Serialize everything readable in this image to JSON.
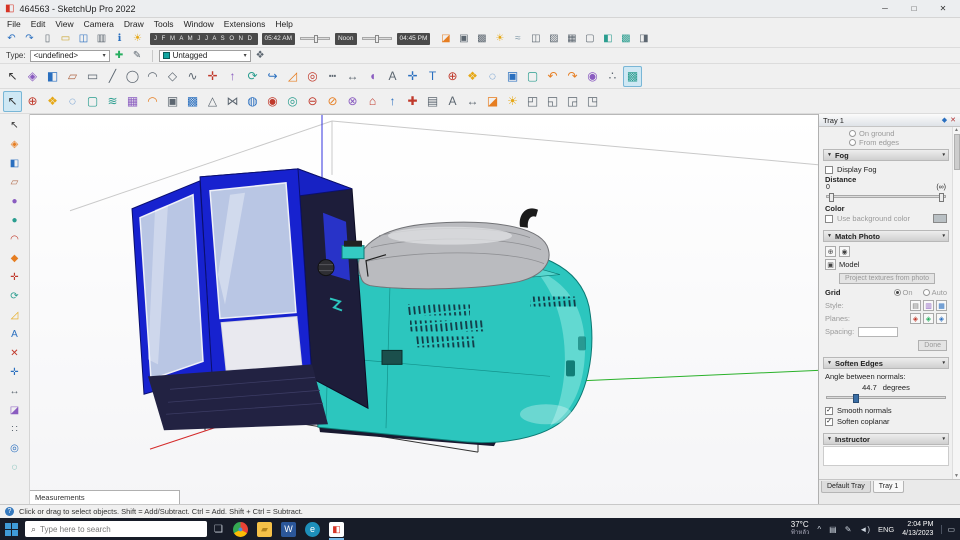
{
  "window": {
    "title": "464563 - SketchUp Pro 2022",
    "logo_glyph": "◧",
    "controls": {
      "min": "─",
      "max": "□",
      "close": "✕"
    }
  },
  "menu": {
    "items": [
      {
        "n": "menu-file",
        "label": "File"
      },
      {
        "n": "menu-edit",
        "label": "Edit"
      },
      {
        "n": "menu-view",
        "label": "View"
      },
      {
        "n": "menu-camera",
        "label": "Camera"
      },
      {
        "n": "menu-draw",
        "label": "Draw"
      },
      {
        "n": "menu-tools",
        "label": "Tools"
      },
      {
        "n": "menu-window",
        "label": "Window"
      },
      {
        "n": "menu-extensions",
        "label": "Extensions"
      },
      {
        "n": "menu-help",
        "label": "Help"
      }
    ]
  },
  "toolbar_a": {
    "left_icons": [
      {
        "n": "undo-icon",
        "g": "↶",
        "c": "#2a6fbf"
      },
      {
        "n": "redo-icon",
        "g": "↷",
        "c": "#2a6fbf"
      },
      {
        "n": "new-file-icon",
        "g": "▯",
        "c": "#5c6670"
      },
      {
        "n": "open-file-icon",
        "g": "▭",
        "c": "#c9a227"
      },
      {
        "n": "save-icon",
        "g": "◫",
        "c": "#2a6fbf"
      },
      {
        "n": "print-icon",
        "g": "▥",
        "c": "#5c6670"
      },
      {
        "n": "model-info-icon",
        "g": "ℹ",
        "c": "#2a6fbf"
      },
      {
        "n": "shadow-settings-icon",
        "g": "☀",
        "c": "#e6a817"
      }
    ],
    "months": "J F M A M J J A S O N D",
    "time_start": "05:42 AM",
    "time_noon": "Noon",
    "time_end": "04:45 PM",
    "right_icons": [
      {
        "n": "section-plane-icon",
        "g": "◪",
        "c": "#e67e22"
      },
      {
        "n": "section-cuts-icon",
        "g": "▣",
        "c": "#5c6670"
      },
      {
        "n": "section-fill-icon",
        "g": "▩",
        "c": "#5c6670"
      },
      {
        "n": "shadows-toggle-icon",
        "g": "☀",
        "c": "#e6a817"
      },
      {
        "n": "fog-toggle-icon",
        "g": "≈",
        "c": "#7f98a8"
      },
      {
        "n": "xray-icon",
        "g": "◫",
        "c": "#5c6670"
      },
      {
        "n": "back-edges-icon",
        "g": "▨",
        "c": "#5c6670"
      },
      {
        "n": "wireframe-icon",
        "g": "▦",
        "c": "#5c6670"
      },
      {
        "n": "hidden-line-icon",
        "g": "▢",
        "c": "#5c6670"
      },
      {
        "n": "shaded-icon",
        "g": "◧",
        "c": "#2a9d8f"
      },
      {
        "n": "textured-icon",
        "g": "▩",
        "c": "#2a9d8f"
      },
      {
        "n": "monochrome-icon",
        "g": "◨",
        "c": "#5c6670"
      }
    ]
  },
  "toolbar_b": {
    "type_label": "Type:",
    "type_value": "<undefined>",
    "tag_value": "Untagged",
    "icons": [
      {
        "n": "add-type-icon",
        "g": "✚",
        "c": "#27ae60"
      },
      {
        "n": "edit-type-icon",
        "g": "✎",
        "c": "#5c6670"
      }
    ],
    "end_icons": [
      {
        "n": "manage-tags-icon",
        "g": "❖",
        "c": "#5c6670"
      }
    ]
  },
  "toolbar_c": {
    "icons": [
      {
        "n": "select-icon",
        "g": "↖",
        "c": "#333333"
      },
      {
        "n": "make-component-icon",
        "g": "◈",
        "c": "#8a5cc0"
      },
      {
        "n": "paint-bucket-icon",
        "g": "◧",
        "c": "#2a6fbf"
      },
      {
        "n": "eraser-icon",
        "g": "▱",
        "c": "#b06a4a"
      },
      {
        "n": "rectangle-icon",
        "g": "▭",
        "c": "#5c6670"
      },
      {
        "n": "line-icon",
        "g": "╱",
        "c": "#5c6670"
      },
      {
        "n": "circle-icon",
        "g": "◯",
        "c": "#5c6670"
      },
      {
        "n": "arc-icon",
        "g": "◠",
        "c": "#5c6670"
      },
      {
        "n": "polygon-icon",
        "g": "◇",
        "c": "#5c6670"
      },
      {
        "n": "freehand-icon",
        "g": "∿",
        "c": "#5c6670"
      },
      {
        "n": "move-icon",
        "g": "✛",
        "c": "#c0392b"
      },
      {
        "n": "push-pull-icon",
        "g": "↑",
        "c": "#8a5cc0"
      },
      {
        "n": "rotate-icon",
        "g": "⟳",
        "c": "#2a9d8f"
      },
      {
        "n": "follow-me-icon",
        "g": "↪",
        "c": "#2a6fbf"
      },
      {
        "n": "scale-icon",
        "g": "◿",
        "c": "#e67e22"
      },
      {
        "n": "offset-icon",
        "g": "◎",
        "c": "#c0392b"
      },
      {
        "n": "tape-measure-icon",
        "g": "┅",
        "c": "#5c6670"
      },
      {
        "n": "dimension-icon",
        "g": "↔",
        "c": "#5c6670"
      },
      {
        "n": "protractor-icon",
        "g": "◖",
        "c": "#8a5cc0"
      },
      {
        "n": "text-tool-icon",
        "g": "A",
        "c": "#5c6670"
      },
      {
        "n": "axes-icon",
        "g": "✛",
        "c": "#2a6fbf"
      },
      {
        "n": "3d-text-icon",
        "g": "T",
        "c": "#2a6fbf"
      },
      {
        "n": "orbit-icon",
        "g": "⊕",
        "c": "#c0392b"
      },
      {
        "n": "pan-icon",
        "g": "❖",
        "c": "#e6a817"
      },
      {
        "n": "zoom-icon",
        "g": "◌",
        "c": "#2a6fbf"
      },
      {
        "n": "zoom-window-icon",
        "g": "▣",
        "c": "#2a6fbf"
      },
      {
        "n": "zoom-extents-icon",
        "g": "▢",
        "c": "#2a9d8f"
      },
      {
        "n": "previous-view-icon",
        "g": "↶",
        "c": "#e67e22"
      },
      {
        "n": "next-view-icon",
        "g": "↷",
        "c": "#e67e22"
      },
      {
        "n": "position-camera-icon",
        "g": "◉",
        "c": "#8a5cc0"
      },
      {
        "n": "walk-icon",
        "g": "∴",
        "c": "#5c6670"
      },
      {
        "n": "shaded-with-textures-icon",
        "g": "▩",
        "c": "#2a9d8f",
        "p": true
      }
    ]
  },
  "toolbar_d": {
    "icons": [
      {
        "n": "select-icon",
        "g": "↖",
        "c": "#333333",
        "p": true
      },
      {
        "n": "orbit-icon",
        "g": "⊕",
        "c": "#c0392b"
      },
      {
        "n": "pan-icon",
        "g": "❖",
        "c": "#e6a817"
      },
      {
        "n": "zoom-icon",
        "g": "◌",
        "c": "#2a6fbf"
      },
      {
        "n": "zoom-extents-icon",
        "g": "▢",
        "c": "#2a9d8f"
      },
      {
        "n": "from-contours-icon",
        "g": "≋",
        "c": "#2a9d8f"
      },
      {
        "n": "from-scratch-icon",
        "g": "▦",
        "c": "#8a5cc0"
      },
      {
        "n": "smoove-icon",
        "g": "◠",
        "c": "#e67e22"
      },
      {
        "n": "stamp-icon",
        "g": "▣",
        "c": "#5c6670"
      },
      {
        "n": "drape-icon",
        "g": "▩",
        "c": "#2a6fbf"
      },
      {
        "n": "add-detail-icon",
        "g": "△",
        "c": "#5c6670"
      },
      {
        "n": "flip-edge-icon",
        "g": "⋈",
        "c": "#5c6670"
      },
      {
        "n": "outer-shell-icon",
        "g": "◍",
        "c": "#2a6fbf"
      },
      {
        "n": "intersect-icon",
        "g": "◉",
        "c": "#c0392b"
      },
      {
        "n": "union-icon",
        "g": "◎",
        "c": "#2a9d8f"
      },
      {
        "n": "subtract-icon",
        "g": "⊖",
        "c": "#c0392b"
      },
      {
        "n": "trim-icon",
        "g": "⊘",
        "c": "#e67e22"
      },
      {
        "n": "split-icon",
        "g": "⊗",
        "c": "#8a5cc0"
      },
      {
        "n": "3d-warehouse-icon",
        "g": "⌂",
        "c": "#c0392b"
      },
      {
        "n": "share-model-icon",
        "g": "↑",
        "c": "#2a6fbf"
      },
      {
        "n": "extension-warehouse-icon",
        "g": "✚",
        "c": "#c0392b"
      },
      {
        "n": "match-photo-icon",
        "g": "▤",
        "c": "#5c6670"
      },
      {
        "n": "text-tool-icon",
        "g": "A",
        "c": "#5c6670"
      },
      {
        "n": "dimension-icon",
        "g": "↔",
        "c": "#5c6670"
      },
      {
        "n": "section-plane-icon",
        "g": "◪",
        "c": "#e67e22"
      },
      {
        "n": "shadows-icon",
        "g": "☀",
        "c": "#e6a817"
      },
      {
        "n": "view-iso-icon",
        "g": "◰",
        "c": "#5c6670"
      },
      {
        "n": "view-top-icon",
        "g": "◱",
        "c": "#5c6670"
      },
      {
        "n": "view-front-icon",
        "g": "◲",
        "c": "#5c6670"
      },
      {
        "n": "view-side-icon",
        "g": "◳",
        "c": "#5c6670"
      }
    ]
  },
  "left_toolbar": {
    "icons": [
      {
        "n": "select-icon",
        "g": "↖",
        "c": "#333333"
      },
      {
        "n": "make-component-icon",
        "g": "◈",
        "c": "#e67e22"
      },
      {
        "n": "paint-bucket-icon",
        "g": "◧",
        "c": "#2a6fbf"
      },
      {
        "n": "eraser-icon",
        "g": "▱",
        "c": "#b06a4a"
      },
      {
        "n": "styles-icon",
        "g": "●",
        "c": "#8a5cc0"
      },
      {
        "n": "materials-icon",
        "g": "●",
        "c": "#2a9d8f"
      },
      {
        "n": "arc-tool-icon",
        "g": "◠",
        "c": "#c0392b"
      },
      {
        "n": "shape-tool-icon",
        "g": "◆",
        "c": "#e67e22"
      },
      {
        "n": "move-tool-icon",
        "g": "✛",
        "c": "#c0392b"
      },
      {
        "n": "rotate-tool-icon",
        "g": "⟳",
        "c": "#2a9d8f"
      },
      {
        "n": "scale-tool-icon",
        "g": "◿",
        "c": "#e6a817"
      },
      {
        "n": "text-tool-icon",
        "g": "A",
        "c": "#2a6fbf"
      },
      {
        "n": "delete-guides-icon",
        "g": "✕",
        "c": "#c0392b"
      },
      {
        "n": "axes-tool-icon",
        "g": "✛",
        "c": "#2a6fbf"
      },
      {
        "n": "dimension-tool-icon",
        "g": "↔",
        "c": "#5c6670"
      },
      {
        "n": "section-plane-icon",
        "g": "◪",
        "c": "#8a5cc0"
      },
      {
        "n": "walk-tool-icon",
        "g": "∷",
        "c": "#5c6670"
      },
      {
        "n": "look-around-icon",
        "g": "◎",
        "c": "#2a6fbf"
      },
      {
        "n": "zoom-tool-icon",
        "g": "◌",
        "c": "#2a9d8f"
      }
    ]
  },
  "tray": {
    "title": "Tray 1",
    "collapse_glyph": "▼",
    "chevron": "▾",
    "partial": {
      "on_ground": "On ground",
      "from_edges": "From edges"
    },
    "fog": {
      "title": "Fog",
      "display_fog": "Display Fog",
      "distance_label": "Distance",
      "min": "0",
      "max": "(∞)",
      "color_label": "Color",
      "use_background": "Use background color"
    },
    "match_photo": {
      "title": "Match Photo",
      "model": "Model",
      "project_btn": "Project textures from photo",
      "grid": "Grid",
      "on": "On",
      "auto": "Auto",
      "style": "Style:",
      "planes": "Planes:",
      "spacing": "Spacing:",
      "done": "Done",
      "top_icons": [
        {
          "n": "add-photo-icon",
          "g": "⊕"
        },
        {
          "n": "toggle-photo-icon",
          "g": "◉"
        }
      ],
      "model_icon": "▣",
      "style_icons": [
        {
          "n": "style-inside-icon",
          "g": "▤",
          "c": "#777777"
        },
        {
          "n": "style-above-icon",
          "g": "▥",
          "c": "#8a5cc0"
        },
        {
          "n": "style-handheld-icon",
          "g": "▦",
          "c": "#2a6fbf"
        }
      ],
      "plane_icons": [
        {
          "n": "plane-red-icon",
          "g": "◈",
          "c": "#c0392b"
        },
        {
          "n": "plane-green-icon",
          "g": "◈",
          "c": "#27ae60"
        },
        {
          "n": "plane-blue-icon",
          "g": "◈",
          "c": "#2a6fbf"
        }
      ]
    },
    "soften": {
      "title": "Soften Edges",
      "angle_label": "Angle between normals:",
      "angle_value": "44.7",
      "degrees": "degrees",
      "smooth": "Smooth normals",
      "coplanar": "Soften coplanar"
    },
    "instructor": {
      "title": "Instructor"
    },
    "tabs": [
      {
        "n": "tab-default-tray",
        "label": "Default Tray"
      },
      {
        "n": "tab-tray-1",
        "label": "Tray 1",
        "cls": "active"
      }
    ]
  },
  "statusbar": {
    "measurements": "Measurements",
    "hint": "Click or drag to select objects. Shift = Add/Subtract. Ctrl = Add. Shift + Ctrl = Subtract."
  },
  "taskbar": {
    "search_placeholder": "Type here to search",
    "icons": {
      "search": "⌕",
      "taskview": "❏",
      "chevron": "^",
      "display": "▤",
      "pen": "✎",
      "volume": "◄)",
      "notif": "▭"
    },
    "apps": [
      {
        "n": "chrome-icon",
        "g": "●",
        "c": "#4a90d9",
        "bg": "conic-gradient(#ea4335 0 120deg,#fbbc05 120deg 240deg,#34a853 240deg 360deg)",
        "cls": "round"
      },
      {
        "n": "folder-icon",
        "g": "▰",
        "c": "#b5841c",
        "bg": "#f6c148"
      },
      {
        "n": "word-icon",
        "g": "W",
        "c": "#ffffff",
        "bg": "#2b579a"
      },
      {
        "n": "edge-icon",
        "g": "e",
        "c": "#ffffff",
        "bg": "#1d8fba",
        "cls": "round"
      },
      {
        "n": "sketchup-icon",
        "g": "◧",
        "c": "#d63426",
        "bg": "#ffffff",
        "cls": "active"
      }
    ],
    "weather_temp": "37°C",
    "weather_text": "ฟ้าหลัว",
    "lang": "ENG",
    "time": "2:04 PM",
    "date": "4/13/2023"
  }
}
